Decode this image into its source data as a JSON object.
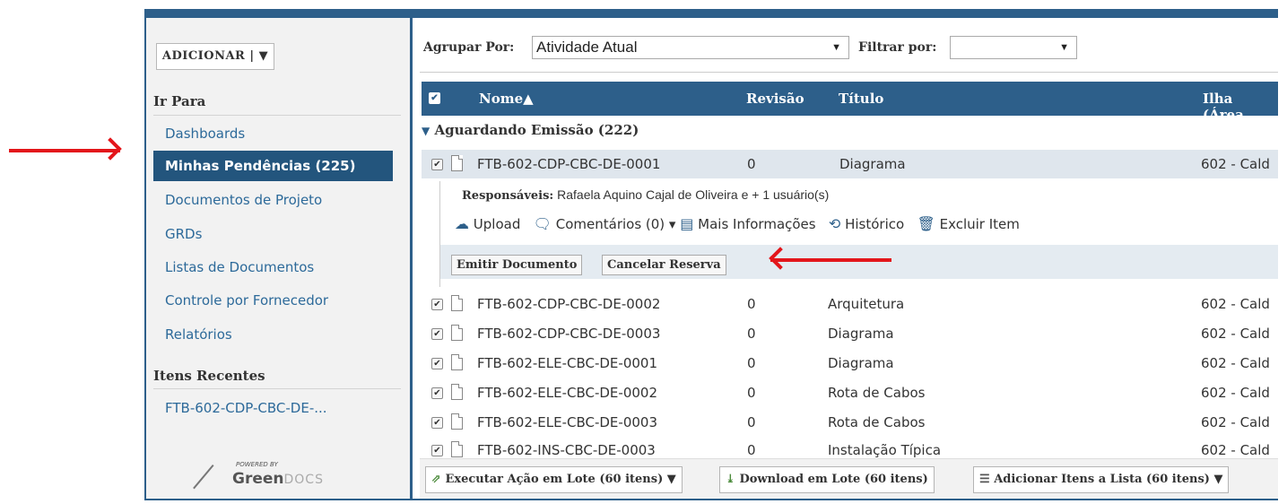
{
  "sidebar": {
    "add_button": "ADICIONAR | ▼",
    "goto_title": "Ir Para",
    "items": [
      {
        "label": "Dashboards"
      },
      {
        "label": "Minhas Pendências (225)",
        "active": true
      },
      {
        "label": "Documentos de Projeto"
      },
      {
        "label": "GRDs"
      },
      {
        "label": "Listas de Documentos"
      },
      {
        "label": "Controle por Fornecedor"
      },
      {
        "label": "Relatórios"
      }
    ],
    "recent_title": "Itens Recentes",
    "recent_items": [
      {
        "label": "FTB-602-CDP-CBC-DE-..."
      }
    ],
    "logo": {
      "powered_by": "POWERED BY",
      "brand_a": "Green",
      "brand_b": "DOCS"
    }
  },
  "filters": {
    "group_label": "Agrupar Por:",
    "group_value": "Atividade Atual",
    "filter_label": "Filtrar por:",
    "filter_value": ""
  },
  "table": {
    "columns": [
      "Nome▲",
      "Revisão",
      "Título",
      "Ilha (Área"
    ],
    "group_header": "Aguardando Emissão (222)",
    "rows": [
      {
        "nome": "FTB-602-CDP-CBC-DE-0001",
        "revisao": "0",
        "titulo": "Diagrama",
        "ilha": "602 - Cald",
        "selected": true
      },
      {
        "nome": "FTB-602-CDP-CBC-DE-0002",
        "revisao": "0",
        "titulo": "Arquitetura",
        "ilha": "602 - Cald"
      },
      {
        "nome": "FTB-602-CDP-CBC-DE-0003",
        "revisao": "0",
        "titulo": "Diagrama",
        "ilha": "602 - Cald"
      },
      {
        "nome": "FTB-602-ELE-CBC-DE-0001",
        "revisao": "0",
        "titulo": "Diagrama",
        "ilha": "602 - Cald"
      },
      {
        "nome": "FTB-602-ELE-CBC-DE-0002",
        "revisao": "0",
        "titulo": "Rota de Cabos",
        "ilha": "602 - Cald"
      },
      {
        "nome": "FTB-602-ELE-CBC-DE-0003",
        "revisao": "0",
        "titulo": "Rota de Cabos",
        "ilha": "602 - Cald"
      },
      {
        "nome": "FTB-602-INS-CBC-DE-0003",
        "revisao": "0",
        "titulo": "Instalação Típica",
        "ilha": "602 - Cald"
      }
    ]
  },
  "detail": {
    "responsaveis_label": "Responsáveis:",
    "responsaveis_value": "Rafaela Aquino Cajal de Oliveira e + 1 usuário(s)",
    "actions": {
      "upload": "Upload",
      "comentarios": "Comentários (0) ▾",
      "mais_info": "Mais Informações",
      "historico": "Histórico",
      "excluir": "Excluir Item"
    },
    "emitir": "Emitir Documento",
    "cancelar": "Cancelar Reserva"
  },
  "footer": {
    "executar": "Executar Ação em Lote (60 itens) ▼",
    "download": "Download em Lote (60 itens)",
    "adicionar": "Adicionar Itens a Lista (60 itens) ▼"
  },
  "annotations": {
    "arrow_color": "#e3161b"
  },
  "colors": {
    "brand_blue": "#2d5f8a",
    "active_nav": "#23557d",
    "link_blue": "#2d6a9a"
  }
}
